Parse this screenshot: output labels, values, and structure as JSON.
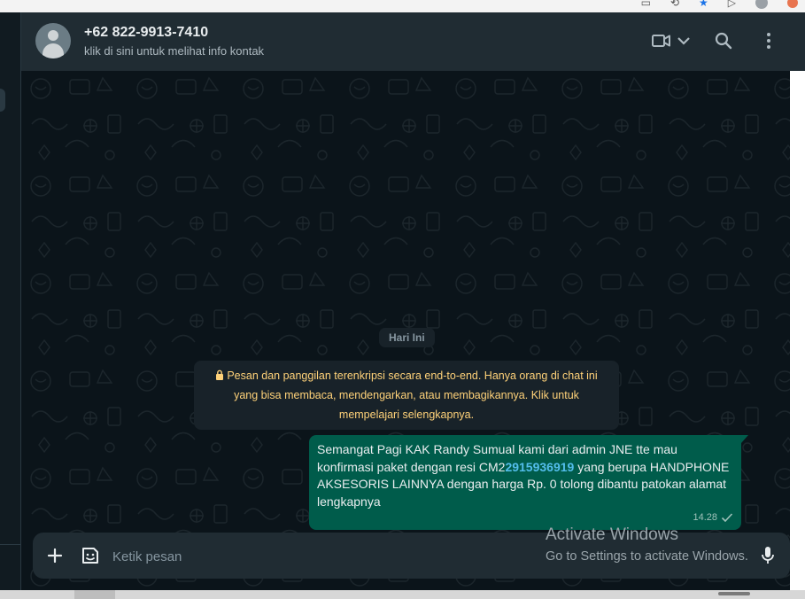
{
  "header": {
    "contact_name": "+62 822-9913-7410",
    "contact_subtitle": "klik di sini untuk melihat info kontak",
    "icons": [
      "avatar-icon",
      "video-call-icon",
      "chevron-down-icon",
      "search-icon",
      "more-vertical-icon"
    ]
  },
  "chat": {
    "date_label": "Hari Ini",
    "encryption_notice": "Pesan dan panggilan terenkripsi secara end-to-end. Hanya orang di chat ini yang bisa membaca, mendengarkan, atau membagikannya. Klik untuk mempelajari selengkapnya.",
    "messages": [
      {
        "direction": "outgoing",
        "text_before": "Semangat Pagi KAK Randy Sumual kami dari admin JNE tte mau konfirmasi paket dengan resi CM2",
        "highlight": "2915936919",
        "text_after": " yang berupa HANDPHONE AKSESORIS LAINNYA dengan harga Rp. 0 tolong dibantu patokan alamat lengkapnya",
        "time": "14.28",
        "status": "delivered"
      }
    ]
  },
  "composer": {
    "placeholder": "Ketik pesan",
    "icons": [
      "plus-icon",
      "sticker-icon",
      "microphone-icon"
    ]
  },
  "watermark": {
    "title": "Activate Windows",
    "subtitle": "Go to Settings to activate Windows."
  },
  "colors": {
    "header_bg": "#202c33",
    "chat_bg": "#0b141a",
    "outgoing_bubble": "#005c4b",
    "notice_text": "#ffd279",
    "link_blue": "#53bdeb"
  }
}
